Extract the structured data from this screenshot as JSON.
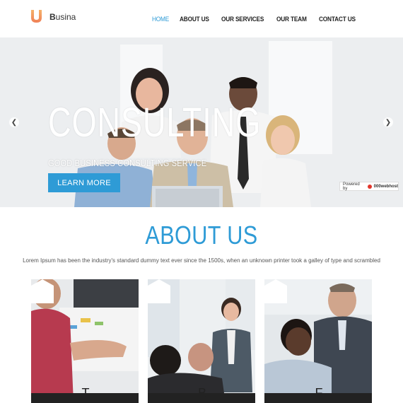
{
  "header": {
    "logo_letter": "U",
    "logo_first": "B",
    "logo_rest": "usina",
    "nav": [
      {
        "label": "HOME",
        "active": true
      },
      {
        "label": "ABOUT US",
        "active": false
      },
      {
        "label": "OUR SERVICES",
        "active": false
      },
      {
        "label": "OUR TEAM",
        "active": false
      },
      {
        "label": "CONTACT US",
        "active": false
      }
    ]
  },
  "hero": {
    "title": "CONSULTING",
    "subtitle": "GOOD BUSINESS CONSULTING SERVICE",
    "button_label": "LEARN MORE",
    "prev_icon": "chevron-left-icon",
    "next_icon": "chevron-right-icon",
    "powered_label": "Powered by",
    "powered_brand": "000webhost"
  },
  "about": {
    "title": "ABOUT US",
    "text": "Lorem Ipsum has been the industry's standard dummy text ever since the 1500s, when an unknown printer took a galley of type and scrambled"
  },
  "cards": [
    {
      "letter": "T"
    },
    {
      "letter": "B"
    },
    {
      "letter": "F"
    }
  ],
  "colors": {
    "accent": "#2e9bd6",
    "logo_orange": "#f08a3c",
    "dark": "#222222"
  }
}
